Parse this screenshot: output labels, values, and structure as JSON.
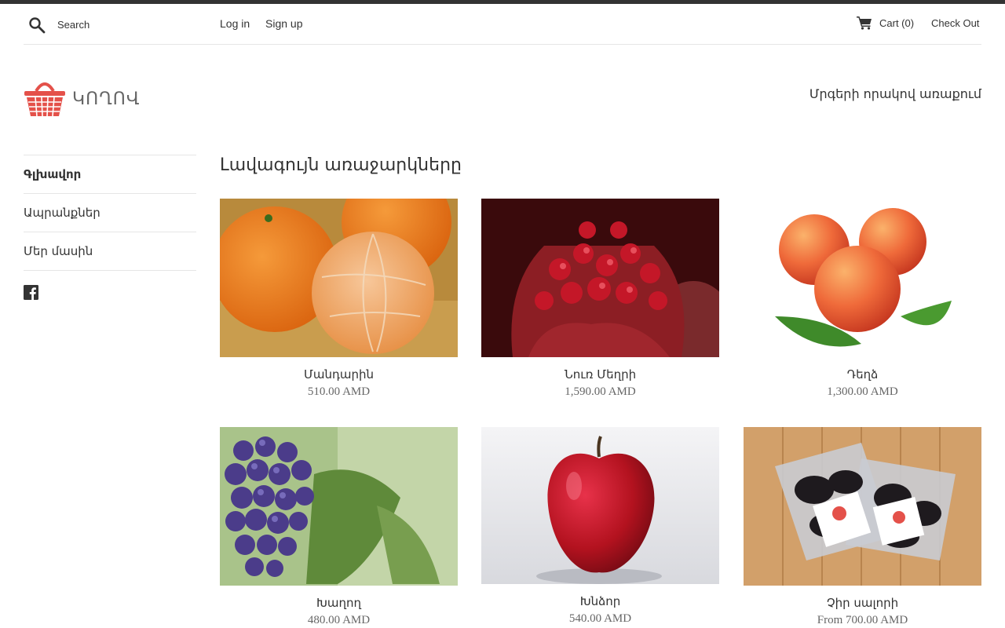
{
  "header": {
    "search_placeholder": "Search",
    "login": "Log in",
    "signup": "Sign up",
    "cart": "Cart (0)",
    "checkout": "Check Out"
  },
  "brand": {
    "name": "ԿՈՂՈՎ",
    "tagline": "Մրգերի որակով առաքում",
    "accent_color": "#e4514a"
  },
  "sidebar": {
    "items": [
      {
        "label": "Գլխավոր",
        "active": true
      },
      {
        "label": "Ապրանքներ",
        "active": false
      },
      {
        "label": "Մեր մասին",
        "active": false
      }
    ],
    "social_icon": "facebook-icon"
  },
  "main": {
    "title": "Լավագույն առաջարկները",
    "products": [
      {
        "name": "Մանդարին",
        "price": "510.00 AMD",
        "image": "tangerine"
      },
      {
        "name": "Նուռ Մեղրի",
        "price": "1,590.00 AMD",
        "image": "pomegranate"
      },
      {
        "name": "Դեղձ",
        "price": "1,300.00 AMD",
        "image": "peach"
      },
      {
        "name": "Խաղող",
        "price": "480.00 AMD",
        "image": "grapes"
      },
      {
        "name": "Խնձոր",
        "price": "540.00 AMD",
        "image": "apple"
      },
      {
        "name": "Չիր սալորի",
        "price": "From 700.00 AMD",
        "image": "dried-plums"
      }
    ]
  }
}
